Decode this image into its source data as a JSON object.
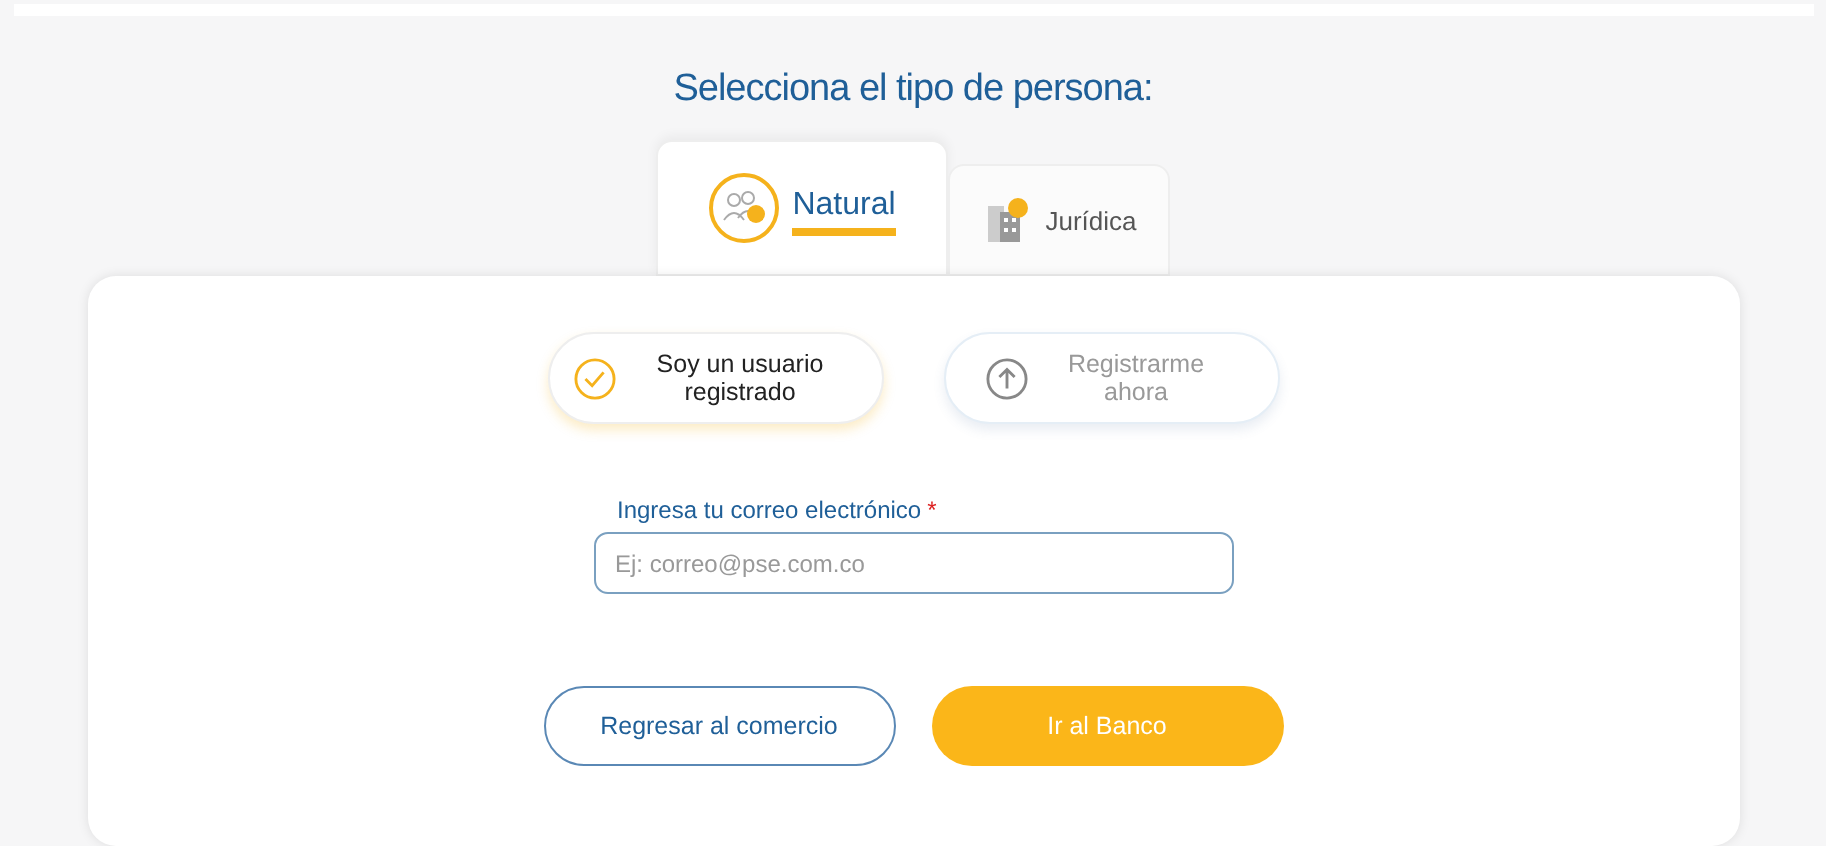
{
  "title": "Selecciona el tipo de persona:",
  "tabs": [
    {
      "label": "Natural",
      "kind": "people",
      "selected": true
    },
    {
      "label": "Jurídica",
      "kind": "building",
      "selected": false
    }
  ],
  "options": [
    {
      "label": "Soy un usuario registrado",
      "kind": "check",
      "selected": true
    },
    {
      "label": "Registrarme ahora",
      "kind": "upload",
      "selected": false
    }
  ],
  "email": {
    "label": "Ingresa tu correo electrónico",
    "required_mark": "*",
    "placeholder": "Ej: correo@pse.com.co"
  },
  "buttons": [
    {
      "label": "Regresar al comercio",
      "kind": "secondary"
    },
    {
      "label": "Ir al Banco",
      "kind": "primary"
    }
  ]
}
